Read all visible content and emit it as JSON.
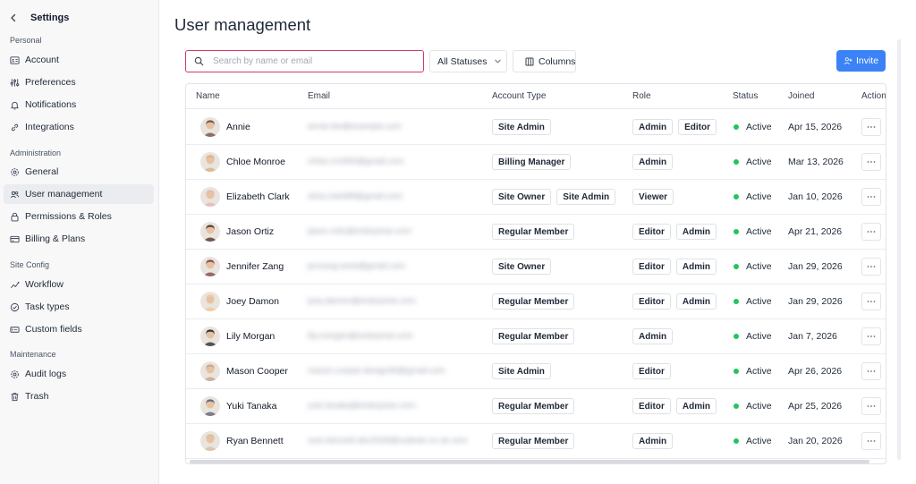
{
  "sidebar": {
    "back_icon": "chevron-left-icon",
    "title": "Settings",
    "sections": [
      {
        "title": "Personal",
        "items": [
          {
            "label": "Account",
            "icon": "id-card-icon"
          },
          {
            "label": "Preferences",
            "icon": "sliders-icon"
          },
          {
            "label": "Notifications",
            "icon": "bell-icon"
          },
          {
            "label": "Integrations",
            "icon": "link-icon"
          }
        ]
      },
      {
        "title": "Administration",
        "items": [
          {
            "label": "General",
            "icon": "gear-icon"
          },
          {
            "label": "User management",
            "icon": "users-icon",
            "active": true
          },
          {
            "label": "Permissions & Roles",
            "icon": "lock-icon"
          },
          {
            "label": "Billing & Plans",
            "icon": "credit-card-icon"
          }
        ]
      },
      {
        "title": "Site Config",
        "items": [
          {
            "label": "Workflow",
            "icon": "workflow-icon"
          },
          {
            "label": "Task types",
            "icon": "check-circle-icon"
          },
          {
            "label": "Custom fields",
            "icon": "input-field-icon"
          }
        ]
      },
      {
        "title": "Maintenance",
        "items": [
          {
            "label": "Audit logs",
            "icon": "gear-icon"
          },
          {
            "label": "Trash",
            "icon": "trash-icon"
          }
        ]
      }
    ]
  },
  "main": {
    "title": "User management",
    "search": {
      "placeholder": "Search by name or email",
      "value": ""
    },
    "status_filter": {
      "label": "All Statuses"
    },
    "columns_button": {
      "label": "Columns"
    },
    "invite_button": {
      "label": "Invite"
    },
    "table": {
      "headers": {
        "name": "Name",
        "email": "Email",
        "account_type": "Account Type",
        "role": "Role",
        "status": "Status",
        "joined": "Joined",
        "actions": "Action"
      },
      "rows": [
        {
          "name": "Annie",
          "email": "annie.lee@example.com",
          "account_types": [
            "Site Admin"
          ],
          "roles": [
            "Admin",
            "Editor"
          ],
          "status": "Active",
          "joined": "Apr 15, 2026",
          "avatar_color": "#7a5a4a"
        },
        {
          "name": "Chloe Monroe",
          "email": "chloe.m1990@gmail.com",
          "account_types": [
            "Billing Manager"
          ],
          "roles": [
            "Admin"
          ],
          "status": "Active",
          "joined": "Mar 13, 2026",
          "avatar_color": "#d9b48a"
        },
        {
          "name": "Elizabeth Clark",
          "email": "eliza.clark88@gmail.com",
          "account_types": [
            "Site Owner",
            "Site Admin"
          ],
          "roles": [
            "Viewer"
          ],
          "status": "Active",
          "joined": "Jan 10, 2026",
          "avatar_color": "#e8b8b8"
        },
        {
          "name": "Jason Ortiz",
          "email": "jason.ortiz@enterprise.com",
          "account_types": [
            "Regular Member"
          ],
          "roles": [
            "Editor",
            "Admin"
          ],
          "status": "Active",
          "joined": "Apr 21, 2026",
          "avatar_color": "#5a4034"
        },
        {
          "name": "Jennifer Zang",
          "email": "jenzang.work@gmail.com",
          "account_types": [
            "Site Owner"
          ],
          "roles": [
            "Editor",
            "Admin"
          ],
          "status": "Active",
          "joined": "Jan 29, 2026",
          "avatar_color": "#8a5050"
        },
        {
          "name": "Joey Damon",
          "email": "joey.damon@enterprise.com",
          "account_types": [
            "Regular Member"
          ],
          "roles": [
            "Editor",
            "Admin"
          ],
          "status": "Active",
          "joined": "Jan 29, 2026",
          "avatar_color": "#f0c8a0"
        },
        {
          "name": "Lily Morgan",
          "email": "lily.morgan@enterprise.com",
          "account_types": [
            "Regular Member"
          ],
          "roles": [
            "Admin"
          ],
          "status": "Active",
          "joined": "Jan 7, 2026",
          "avatar_color": "#3a3a3a"
        },
        {
          "name": "Mason Cooper",
          "email": "mason.cooper.design99@gmail.com",
          "account_types": [
            "Site Admin"
          ],
          "roles": [
            "Editor"
          ],
          "status": "Active",
          "joined": "Apr 26, 2026",
          "avatar_color": "#c8a890"
        },
        {
          "name": "Yuki Tanaka",
          "email": "yuki.tanaka@enterprise.com",
          "account_types": [
            "Regular Member"
          ],
          "roles": [
            "Editor",
            "Admin"
          ],
          "status": "Active",
          "joined": "Apr 25, 2026",
          "avatar_color": "#6a6a7a"
        },
        {
          "name": "Ryan Bennett",
          "email": "ryan.bennett.dev2026@outlook.co.uk.com",
          "account_types": [
            "Regular Member"
          ],
          "roles": [
            "Admin"
          ],
          "status": "Active",
          "joined": "Jan 20, 2026",
          "avatar_color": "#d8c0a0"
        }
      ]
    }
  },
  "colors": {
    "accent": "#3b82f6",
    "search_focus": "#cf3a64",
    "status_active": "#22c55e"
  }
}
